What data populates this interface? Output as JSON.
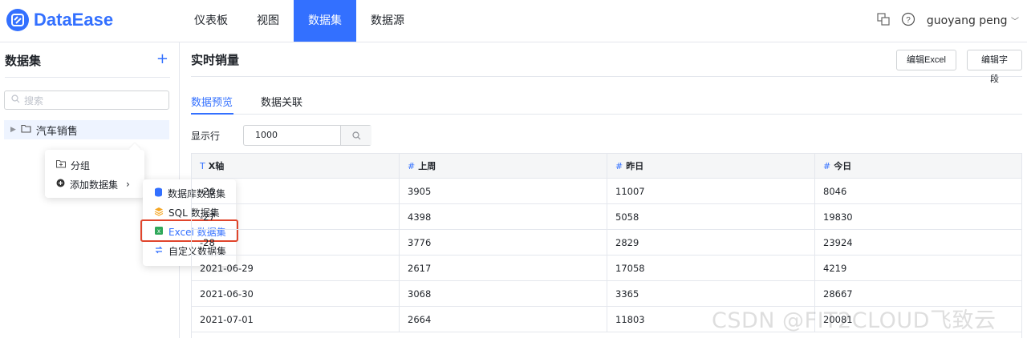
{
  "app": {
    "name": "DataEase"
  },
  "nav": {
    "items": [
      "仪表板",
      "视图",
      "数据集",
      "数据源"
    ],
    "active_index": 2
  },
  "header": {
    "user": "guoyang peng"
  },
  "sidebar": {
    "title": "数据集",
    "search_placeholder": "搜索",
    "tree": [
      {
        "label": "汽车销售"
      }
    ]
  },
  "context_menu": {
    "group_label": "分组",
    "add_label": "添加数据集"
  },
  "submenu": {
    "items": [
      "数据库数据集",
      "SQL 数据集",
      "Excel 数据集",
      "自定义数据集"
    ],
    "highlighted_index": 2
  },
  "main": {
    "title": "实时销量",
    "edit_excel_label": "编辑Excel",
    "edit_fields_label": "编辑字段",
    "tabs": [
      "数据预览",
      "数据关联"
    ],
    "active_tab": 0,
    "rows_label": "显示行",
    "rows_value": "1000"
  },
  "table": {
    "columns": [
      {
        "type": "T",
        "name": "X轴"
      },
      {
        "type": "#",
        "name": "上周"
      },
      {
        "type": "#",
        "name": "昨日"
      },
      {
        "type": "#",
        "name": "今日"
      }
    ],
    "rows": [
      [
        "-26",
        "3905",
        "11007",
        "8046"
      ],
      [
        "-27",
        "4398",
        "5058",
        "19830"
      ],
      [
        "-28",
        "3776",
        "2829",
        "23924"
      ],
      [
        "2021-06-29",
        "2617",
        "17058",
        "4219"
      ],
      [
        "2021-06-30",
        "3068",
        "3365",
        "28667"
      ],
      [
        "2021-07-01",
        "2664",
        "11803",
        "20081"
      ]
    ]
  },
  "watermark": "CSDN @FIT2CLOUD飞致云",
  "colors": {
    "accent": "#3370ff",
    "highlight_border": "#e0452c"
  }
}
